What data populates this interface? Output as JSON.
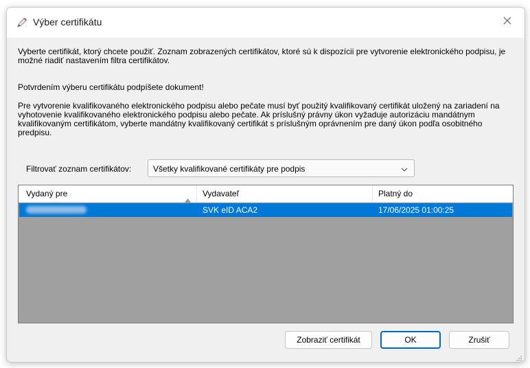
{
  "window": {
    "title": "Výber certifikátu",
    "title_icon": "pen-certificate-icon",
    "close_icon": "close-icon"
  },
  "content": {
    "paragraph1": "Vyberte certifikát, ktorý chcete použiť. Zoznam zobrazených certifikátov, ktoré sú k dispozícii pre vytvorenie elektronického podpisu, je možné riadiť nastavením filtra certifikátov.",
    "paragraph2": "Potvrdením výberu certifikátu podpíšete dokument!",
    "paragraph3": "Pre vytvorenie kvalifikovaného elektronického podpisu alebo pečate musí byť použitý kvalifikovaný certifikát uložený na zariadení na vyhotovenie kvalifikovaného elektronického podpisu alebo pečate. Ak príslušný právny úkon vyžaduje autorizáciu mandátnym kvalifikovaným certifikátom, vyberte mandátny kvalifikovaný certifikát s príslušným oprávnením pre daný úkon podľa osobitného predpisu."
  },
  "filter": {
    "label": "Filtrovať zoznam certifikátov:",
    "selected": "Všetky kvalifikované certifikáty pre podpis",
    "icon": "chevron-down-icon"
  },
  "table": {
    "columns": [
      "Vydaný pre",
      "Vydavateľ",
      "Platný do"
    ],
    "sort_icon": "sort-ascending-icon",
    "rows": [
      {
        "issued_to": "",
        "issuer": "SVK eID ACA2",
        "valid_to": "17/06/2025 01:00:25",
        "selected": true
      }
    ]
  },
  "buttons": {
    "view": "Zobraziť certifikát",
    "ok": "OK",
    "cancel": "Zrušiť"
  },
  "colors": {
    "selection": "#0078d7",
    "list_background": "#a0a0a0",
    "ok_border": "#0067c0"
  }
}
